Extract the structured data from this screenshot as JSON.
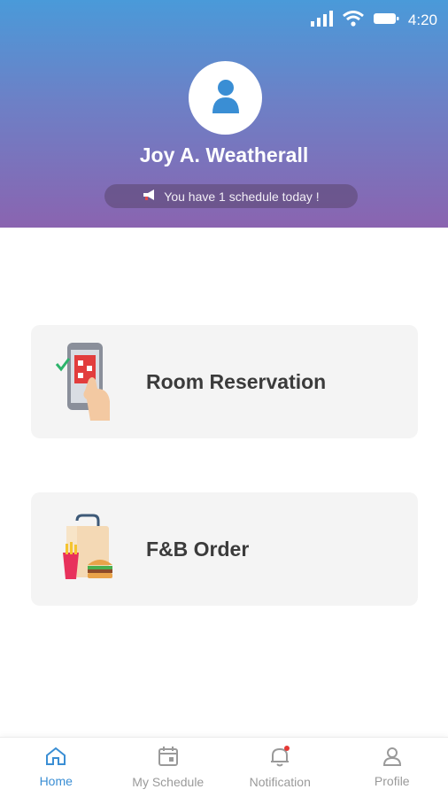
{
  "status_bar": {
    "time": "4:20"
  },
  "profile": {
    "name": "Joy A. Weatherall",
    "notice": "You have 1 schedule today !"
  },
  "menu": {
    "cards": [
      {
        "label": "Room Reservation",
        "icon": "phone-touch-icon"
      },
      {
        "label": "F&B Order",
        "icon": "food-bag-icon"
      }
    ]
  },
  "bottom_nav": {
    "items": [
      {
        "label": "Home",
        "icon": "home-icon",
        "active": true
      },
      {
        "label": "My Schedule",
        "icon": "calendar-icon",
        "active": false
      },
      {
        "label": "Notification",
        "icon": "bell-icon",
        "active": false
      },
      {
        "label": "Profile",
        "icon": "user-icon",
        "active": false
      }
    ]
  },
  "colors": {
    "header_top": "#4a9ad9",
    "header_bottom": "#8a64b0",
    "accent": "#3a8ed4",
    "card_bg": "#f4f4f4"
  }
}
